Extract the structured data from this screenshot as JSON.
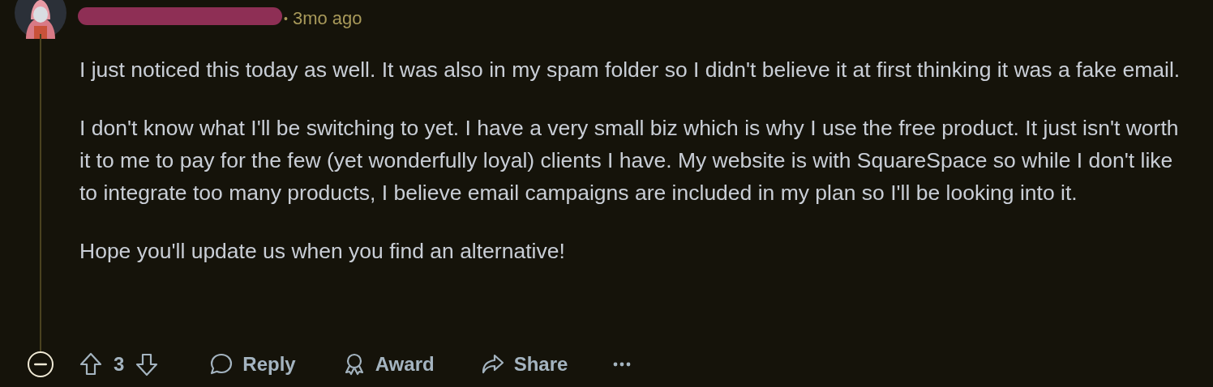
{
  "comment": {
    "author_redacted": true,
    "separator": "•",
    "time": "3mo ago",
    "paragraphs": [
      "I just noticed this today as well. It was also in my spam folder so I didn't believe it at first thinking it was a fake email.",
      "I don't know what I'll be switching to yet. I have a very small biz which is why I use the free product. It just isn't worth it to me to pay for the few (yet wonderfully loyal) clients I have. My website is with SquareSpace so while I don't like to integrate too many products, I believe email campaigns are included in my plan so I'll be looking into it.",
      "Hope you'll update us when you find an alternative!"
    ],
    "expanded": true,
    "score": "3",
    "actions": [
      {
        "kind": "reply",
        "label": "Reply"
      },
      {
        "kind": "award",
        "label": "Award"
      },
      {
        "kind": "share",
        "label": "Share"
      }
    ]
  }
}
